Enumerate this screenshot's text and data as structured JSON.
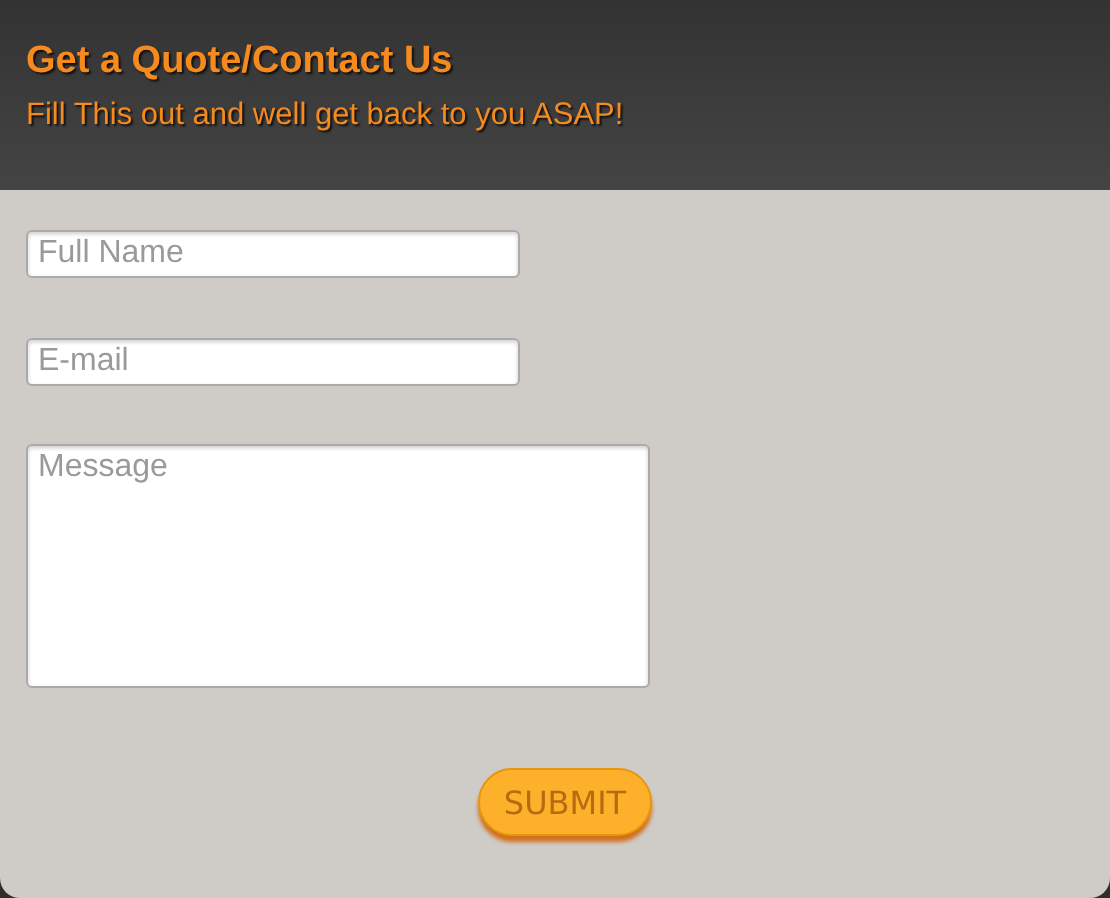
{
  "header": {
    "title": "Get a Quote/Contact Us",
    "subtitle": "Fill This out and well get back to you ASAP!"
  },
  "fields": [
    {
      "kind": "input",
      "placeholder": "Full Name"
    },
    {
      "kind": "input",
      "placeholder": "E-mail"
    },
    {
      "kind": "textarea",
      "placeholder": "Message"
    }
  ],
  "submit": "SUBMIT"
}
